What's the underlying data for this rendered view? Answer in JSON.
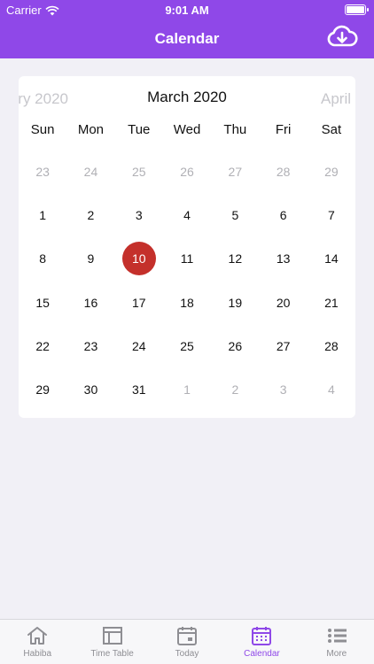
{
  "status_bar": {
    "carrier": "Carrier",
    "time": "9:01 AM"
  },
  "header": {
    "title": "Calendar"
  },
  "calendar": {
    "prev_month": "ry 2020",
    "current_month": "March 2020",
    "next_month": "April",
    "weekdays": [
      "Sun",
      "Mon",
      "Tue",
      "Wed",
      "Thu",
      "Fri",
      "Sat"
    ],
    "selected_day": "10",
    "weeks": [
      [
        "23",
        "24",
        "25",
        "26",
        "27",
        "28",
        "29"
      ],
      [
        "1",
        "2",
        "3",
        "4",
        "5",
        "6",
        "7"
      ],
      [
        "8",
        "9",
        "10",
        "11",
        "12",
        "13",
        "14"
      ],
      [
        "15",
        "16",
        "17",
        "18",
        "19",
        "20",
        "21"
      ],
      [
        "22",
        "23",
        "24",
        "25",
        "26",
        "27",
        "28"
      ],
      [
        "29",
        "30",
        "31",
        "1",
        "2",
        "3",
        "4"
      ]
    ],
    "muted": [
      [
        true,
        true,
        true,
        true,
        true,
        true,
        true
      ],
      [
        false,
        false,
        false,
        false,
        false,
        false,
        false
      ],
      [
        false,
        false,
        false,
        false,
        false,
        false,
        false
      ],
      [
        false,
        false,
        false,
        false,
        false,
        false,
        false
      ],
      [
        false,
        false,
        false,
        false,
        false,
        false,
        false
      ],
      [
        false,
        false,
        false,
        true,
        true,
        true,
        true
      ]
    ]
  },
  "tabs": [
    {
      "label": "Habiba",
      "icon": "home-icon",
      "active": false
    },
    {
      "label": "Time Table",
      "icon": "table-icon",
      "active": false
    },
    {
      "label": "Today",
      "icon": "today-calendar-icon",
      "active": false
    },
    {
      "label": "Calendar",
      "icon": "calendar-icon",
      "active": true
    },
    {
      "label": "More",
      "icon": "list-icon",
      "active": false
    }
  ],
  "colors": {
    "accent": "#8f48e8",
    "selected_day": "#c4302b",
    "inactive_tab": "#8e8e93"
  }
}
